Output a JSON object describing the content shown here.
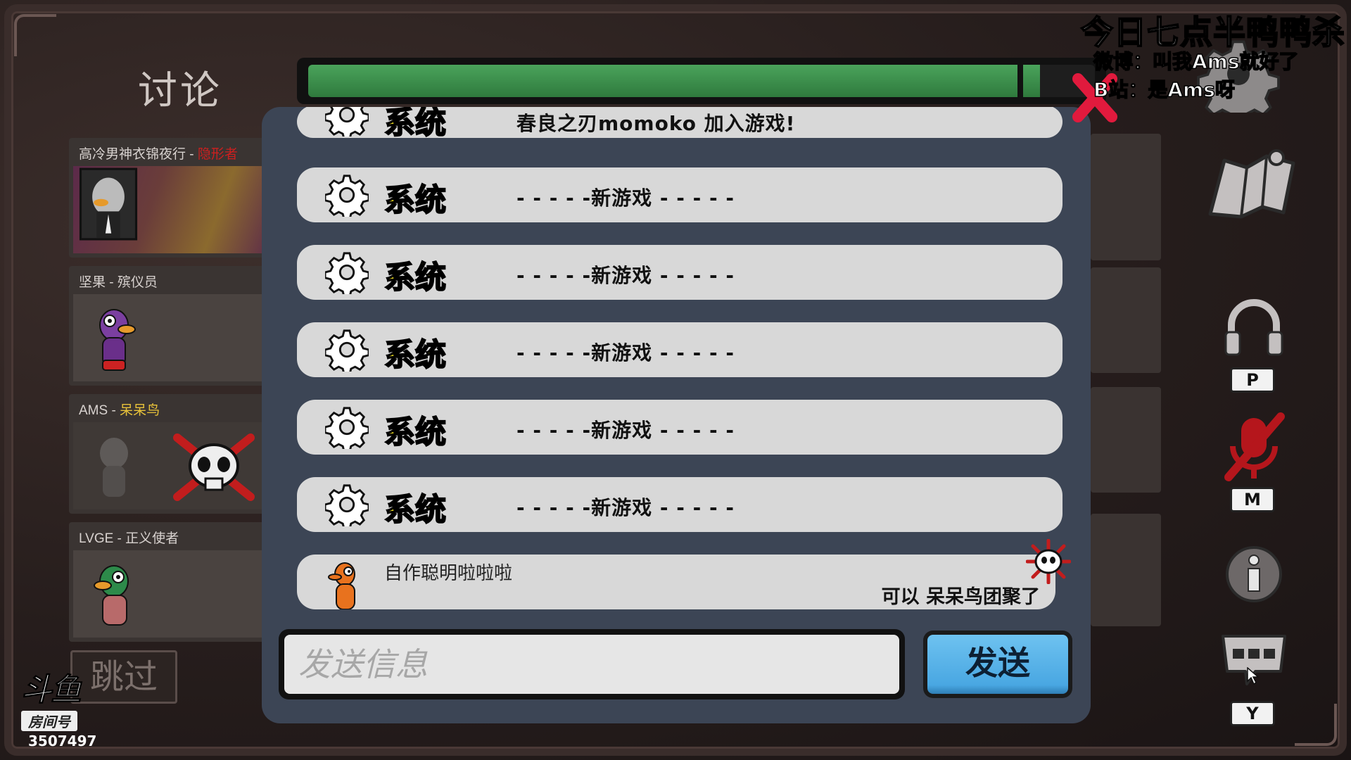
{
  "screen": {
    "title": "讨论",
    "timer_progress": 0.93
  },
  "players": [
    {
      "name": "高冷男神衣锦夜行",
      "separator": " - ",
      "role": "隐形者",
      "role_color": "#cc1f1f"
    },
    {
      "name": "坚果",
      "separator": " - ",
      "role": "殡仪员",
      "role_color": "#d8d2cf"
    },
    {
      "name": "AMS",
      "separator": " - ",
      "role": "呆呆鸟",
      "role_color": "#e8c23a",
      "dead": true
    },
    {
      "name": "LVGE",
      "separator": " - ",
      "role": "正义使者",
      "role_color": "#d8d2cf"
    }
  ],
  "skip_button": "跳过",
  "chat": {
    "system_label": "系统",
    "messages": [
      {
        "text": "春良之刃momoko 加入游戏!"
      },
      {
        "text": "- - - - -新游戏 - - - - -"
      },
      {
        "text": "- - - - -新游戏 - - - - -"
      },
      {
        "text": "- - - - -新游戏 - - - - -"
      },
      {
        "text": "- - - - -新游戏 - - - - -"
      },
      {
        "text": "- - - - -新游戏 - - - - -"
      }
    ],
    "player_message": {
      "sender": "自作聪明啦啦啦",
      "content": "可以 呆呆鸟团聚了"
    },
    "input_placeholder": "发送信息",
    "send_label": "发送"
  },
  "right_sidebar": {
    "keys": {
      "voice": "P",
      "mute": "M",
      "chat": "Y"
    },
    "icons": [
      "settings-gear-icon",
      "map-icon",
      "headphones-icon",
      "muted-microphone-icon",
      "info-icon",
      "chat-bubble-icon"
    ]
  },
  "overlay": {
    "title": "今日七点半鸭鸭杀",
    "weibo": "微博：叫我Ams就好了",
    "bilibili": "B站：是Ams呀"
  },
  "platform": {
    "logo": "斗鱼",
    "room_label": "房间号",
    "room_number": "3507497"
  },
  "colors": {
    "timer_green": "#3b8f4c",
    "system_label_yellow": "#f4e420",
    "send_button_blue": "#49a7e2",
    "chat_panel_bg": "#3c4555"
  }
}
